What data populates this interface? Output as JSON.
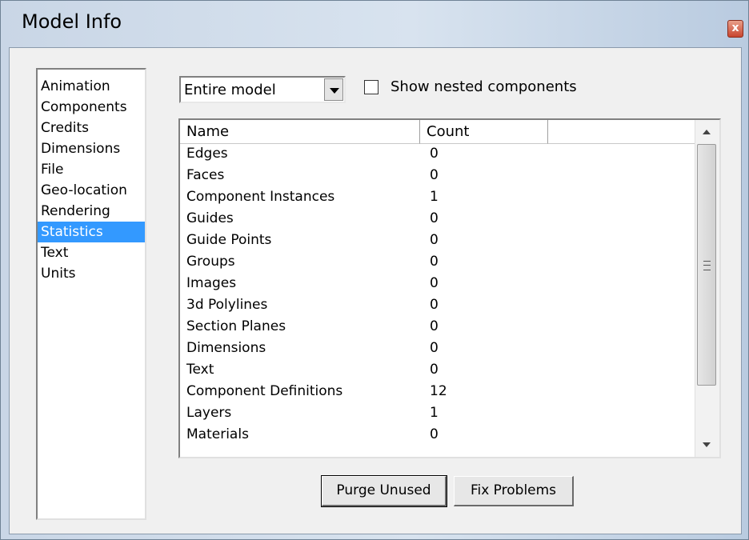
{
  "window": {
    "title": "Model Info",
    "close_glyph": "x"
  },
  "categories": [
    {
      "label": "Animation",
      "selected": false
    },
    {
      "label": "Components",
      "selected": false
    },
    {
      "label": "Credits",
      "selected": false
    },
    {
      "label": "Dimensions",
      "selected": false
    },
    {
      "label": "File",
      "selected": false
    },
    {
      "label": "Geo-location",
      "selected": false
    },
    {
      "label": "Rendering",
      "selected": false
    },
    {
      "label": "Statistics",
      "selected": true
    },
    {
      "label": "Text",
      "selected": false
    },
    {
      "label": "Units",
      "selected": false
    }
  ],
  "scope": {
    "selected": "Entire model"
  },
  "nested": {
    "label": "Show nested components",
    "checked": false
  },
  "table": {
    "headers": {
      "name": "Name",
      "count": "Count"
    },
    "rows": [
      {
        "name": "Edges",
        "count": "0"
      },
      {
        "name": "Faces",
        "count": "0"
      },
      {
        "name": "Component Instances",
        "count": "1"
      },
      {
        "name": "Guides",
        "count": "0"
      },
      {
        "name": "Guide Points",
        "count": "0"
      },
      {
        "name": "Groups",
        "count": "0"
      },
      {
        "name": "Images",
        "count": "0"
      },
      {
        "name": "3d Polylines",
        "count": "0"
      },
      {
        "name": "Section Planes",
        "count": "0"
      },
      {
        "name": "Dimensions",
        "count": "0"
      },
      {
        "name": "Text",
        "count": "0"
      },
      {
        "name": "Component Definitions",
        "count": "12"
      },
      {
        "name": "Layers",
        "count": "1"
      },
      {
        "name": "Materials",
        "count": "0"
      }
    ]
  },
  "buttons": {
    "purge": "Purge Unused",
    "fix": "Fix Problems"
  },
  "colors": {
    "selection": "#3399ff",
    "dialog_bg": "#f0f0f0",
    "close_red": "#c8452f"
  }
}
